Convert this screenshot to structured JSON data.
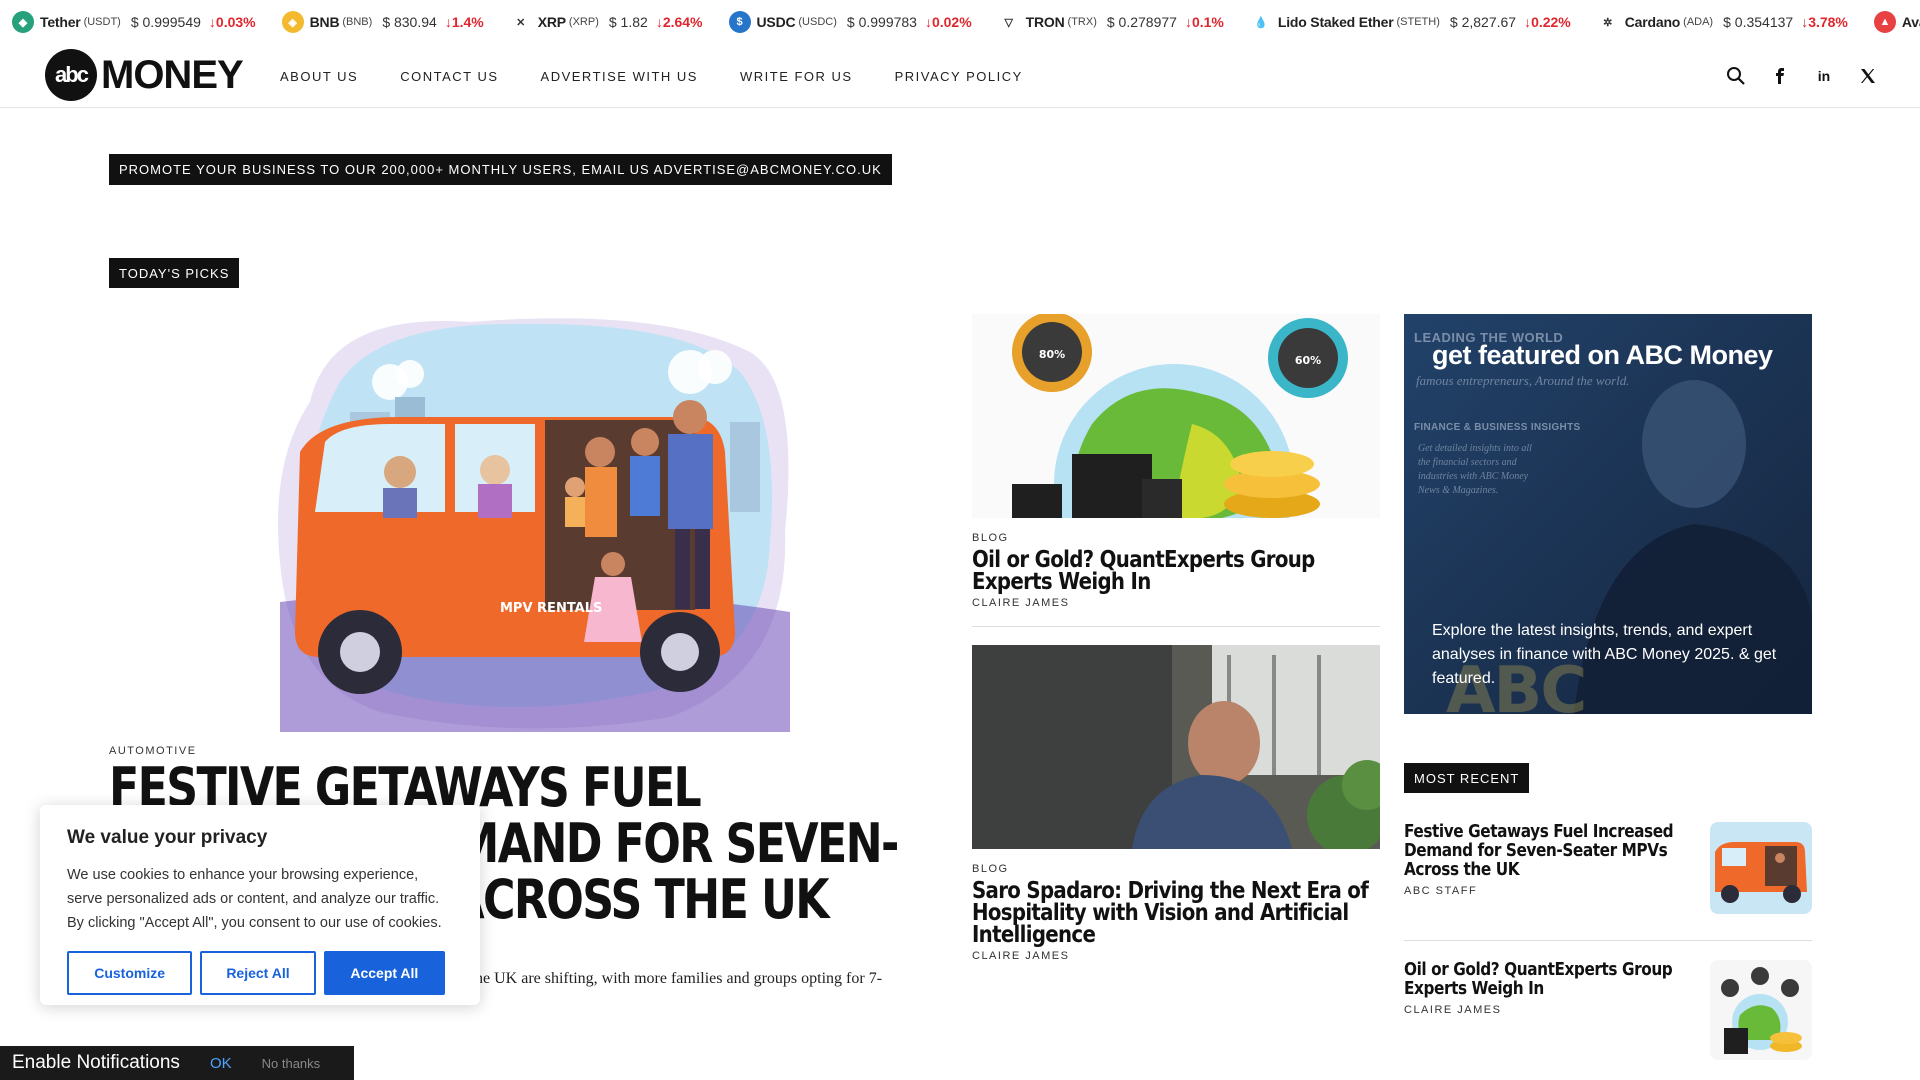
{
  "ticker": [
    {
      "name": "Tether",
      "symbol": "(USDT)",
      "price": "$ 0.999549",
      "change": "0.03%",
      "color": "#26a17b",
      "glyph": "◆"
    },
    {
      "name": "BNB",
      "symbol": "(BNB)",
      "price": "$ 830.94",
      "change": "1.4%",
      "color": "#f3ba2f",
      "glyph": "◈"
    },
    {
      "name": "XRP",
      "symbol": "(XRP)",
      "price": "$ 1.82",
      "change": "2.64%",
      "color": "#ffffff",
      "glyph": "✕"
    },
    {
      "name": "USDC",
      "symbol": "(USDC)",
      "price": "$ 0.999783",
      "change": "0.02%",
      "color": "#2775ca",
      "glyph": "$"
    },
    {
      "name": "TRON",
      "symbol": "(TRX)",
      "price": "$ 0.278977",
      "change": "0.1%",
      "color": "#ffffff",
      "glyph": "▽"
    },
    {
      "name": "Lido Staked Ether",
      "symbol": "(STETH)",
      "price": "$ 2,827.67",
      "change": "0.22%",
      "color": "#ffffff",
      "glyph": "💧"
    },
    {
      "name": "Cardano",
      "symbol": "(ADA)",
      "price": "$ 0.354137",
      "change": "3.78%",
      "color": "#ffffff",
      "glyph": "✲"
    },
    {
      "name": "Avalanche",
      "symbol": "(AV",
      "price": "",
      "change": "",
      "color": "#e84142",
      "glyph": "▲"
    }
  ],
  "nav": {
    "logo_mark": "abc",
    "logo_text": "MONEY",
    "links": [
      "ABOUT US",
      "CONTACT US",
      "ADVERTISE WITH US",
      "WRITE FOR US",
      "PRIVACY POLICY"
    ],
    "linkedin": "in"
  },
  "promo": "PROMOTE YOUR BUSINESS TO OUR 200,000+ MONTHLY USERS, EMAIL US ADVERTISE@ABCMONEY.CO.UK",
  "picks_label": "TODAY'S PICKS",
  "hero": {
    "category": "AUTOMOTIVE",
    "title": "FESTIVE GETAWAYS FUEL INCREASED DEMAND FOR SEVEN-SEATER MPVS ACROSS THE UK",
    "excerpt": "he UK are shifting, with more families and groups opting for 7-",
    "van_label": "MPV RENTALS"
  },
  "cards": [
    {
      "category": "BLOG",
      "title": "Oil or Gold? QuantExperts Group Experts Weigh In",
      "author": "CLAIRE JAMES",
      "badge_left": "80%",
      "badge_right": "60%"
    },
    {
      "category": "BLOG",
      "title": "Saro Spadaro: Driving the Next Era of Hospitality with Vision and Artificial Intelligence",
      "author": "CLAIRE JAMES"
    }
  ],
  "featured": {
    "lead": "LEADING THE WORLD",
    "title": "get featured on ABC Money",
    "script": "famous entrepreneurs, Around the world.",
    "insights": "FINANCE & BUSINESS INSIGHTS",
    "script2": "Get detailed insights into all the financial sectors and industries with ABC Money News & Magazines.",
    "description": "Explore the latest insights, trends, and expert analyses in finance with ABC Money 2025. & get featured.",
    "bigtext": "ABC MONEY"
  },
  "most_recent": {
    "label": "MOST RECENT",
    "items": [
      {
        "title": "Festive Getaways Fuel Increased Demand for Seven-Seater MPVs Across the UK",
        "author": "ABC STAFF"
      },
      {
        "title": "Oil or Gold? QuantExperts Group Experts Weigh In",
        "author": "CLAIRE JAMES"
      }
    ]
  },
  "cookie": {
    "title": "We value your privacy",
    "text": "We use cookies to enhance your browsing experience, serve personalized ads or content, and analyze our traffic. By clicking \"Accept All\", you consent to our use of cookies.",
    "customize": "Customize",
    "reject": "Reject All",
    "accept": "Accept All"
  },
  "notify": {
    "label": "Enable Notifications",
    "ok": "OK",
    "no": "No thanks"
  }
}
